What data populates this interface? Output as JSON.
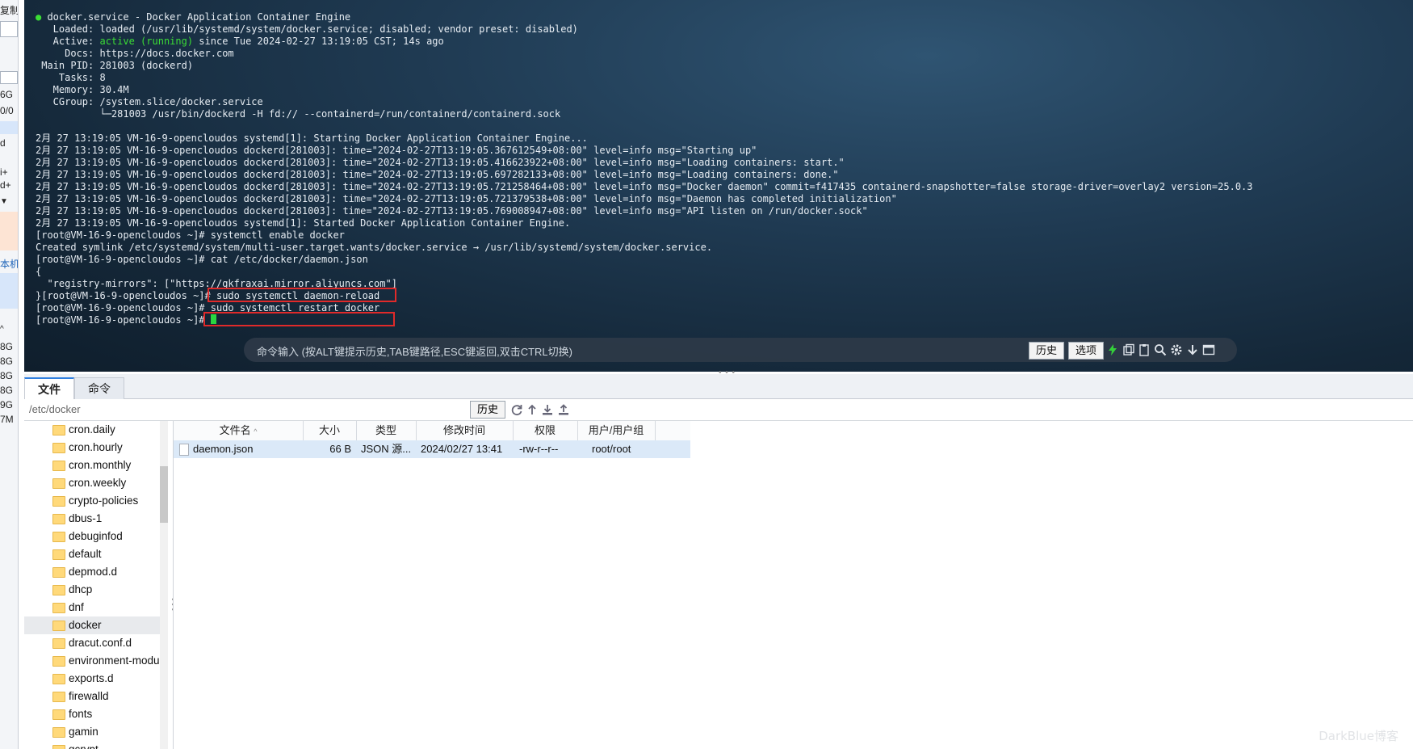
{
  "left_strip": {
    "labels": [
      "复制",
      "6G",
      "0/0",
      "d",
      "i+",
      "d+",
      "本机",
      "8G",
      "8G",
      "8G",
      "8G",
      "9G",
      "7M"
    ]
  },
  "terminal": {
    "lines": [
      " docker.service - Docker Application Container Engine",
      "   Loaded: loaded (/usr/lib/systemd/system/docker.service; disabled; vendor preset: disabled)",
      "   Active: ",
      "     Docs: https://docs.docker.com",
      " Main PID: 281003 (dockerd)",
      "    Tasks: 8",
      "   Memory: 30.4M",
      "   CGroup: /system.slice/docker.service",
      "           └─281003 /usr/bin/dockerd -H fd:// --containerd=/run/containerd/containerd.sock",
      "",
      "2月 27 13:19:05 VM-16-9-opencloudos systemd[1]: Starting Docker Application Container Engine...",
      "2月 27 13:19:05 VM-16-9-opencloudos dockerd[281003]: time=\"2024-02-27T13:19:05.367612549+08:00\" level=info msg=\"Starting up\"",
      "2月 27 13:19:05 VM-16-9-opencloudos dockerd[281003]: time=\"2024-02-27T13:19:05.416623922+08:00\" level=info msg=\"Loading containers: start.\"",
      "2月 27 13:19:05 VM-16-9-opencloudos dockerd[281003]: time=\"2024-02-27T13:19:05.697282133+08:00\" level=info msg=\"Loading containers: done.\"",
      "2月 27 13:19:05 VM-16-9-opencloudos dockerd[281003]: time=\"2024-02-27T13:19:05.721258464+08:00\" level=info msg=\"Docker daemon\" commit=f417435 containerd-snapshotter=false storage-driver=overlay2 version=25.0.3",
      "2月 27 13:19:05 VM-16-9-opencloudos dockerd[281003]: time=\"2024-02-27T13:19:05.721379538+08:00\" level=info msg=\"Daemon has completed initialization\"",
      "2月 27 13:19:05 VM-16-9-opencloudos dockerd[281003]: time=\"2024-02-27T13:19:05.769008947+08:00\" level=info msg=\"API listen on /run/docker.sock\"",
      "2月 27 13:19:05 VM-16-9-opencloudos systemd[1]: Started Docker Application Container Engine.",
      "[root@VM-16-9-opencloudos ~]# systemctl enable docker",
      "Created symlink /etc/systemd/system/multi-user.target.wants/docker.service → /usr/lib/systemd/system/docker.service.",
      "[root@VM-16-9-opencloudos ~]# cat /etc/docker/daemon.json",
      "{",
      "  \"registry-mirrors\": [\"https://gkfraxai.mirror.aliyuncs.com\"]",
      "}[root@VM-16-9-opencloudos ~]# sudo systemctl daemon-reload",
      "[root@VM-16-9-opencloudos ~]# sudo systemctl restart docker",
      "[root@VM-16-9-opencloudos ~]# "
    ],
    "active_state": "active (running)",
    "active_since": " since Tue 2024-02-27 13:19:05 CST; 14s ago",
    "status_dot": "●",
    "cmd_hint": "命令输入 (按ALT键提示历史,TAB键路径,ESC键返回,双击CTRL切换)",
    "history_label": "历史",
    "options_label": "选项",
    "accent_green": "#3bdd35",
    "highlight_red": "#e02a2a"
  },
  "tabs": [
    {
      "label": "文件",
      "active": true
    },
    {
      "label": "命令",
      "active": false
    }
  ],
  "path_bar": {
    "path": "/etc/docker",
    "history_label": "历史"
  },
  "tree": {
    "items": [
      "cron.daily",
      "cron.hourly",
      "cron.monthly",
      "cron.weekly",
      "crypto-policies",
      "dbus-1",
      "debuginfod",
      "default",
      "depmod.d",
      "dhcp",
      "dnf",
      "docker",
      "dracut.conf.d",
      "environment-modules",
      "exports.d",
      "firewalld",
      "fonts",
      "gamin",
      "gcrypt"
    ],
    "selected": "docker"
  },
  "file_table": {
    "headers": {
      "name": "文件名",
      "size": "大小",
      "type": "类型",
      "mtime": "修改时间",
      "perm": "权限",
      "owner": "用户/用户组"
    },
    "rows": [
      {
        "name": "daemon.json",
        "size": "66 B",
        "type": "JSON 源...",
        "mtime": "2024/02/27 13:41",
        "perm": "-rw-r--r--",
        "owner": "root/root"
      }
    ]
  },
  "watermark": "DarkBlue博客"
}
